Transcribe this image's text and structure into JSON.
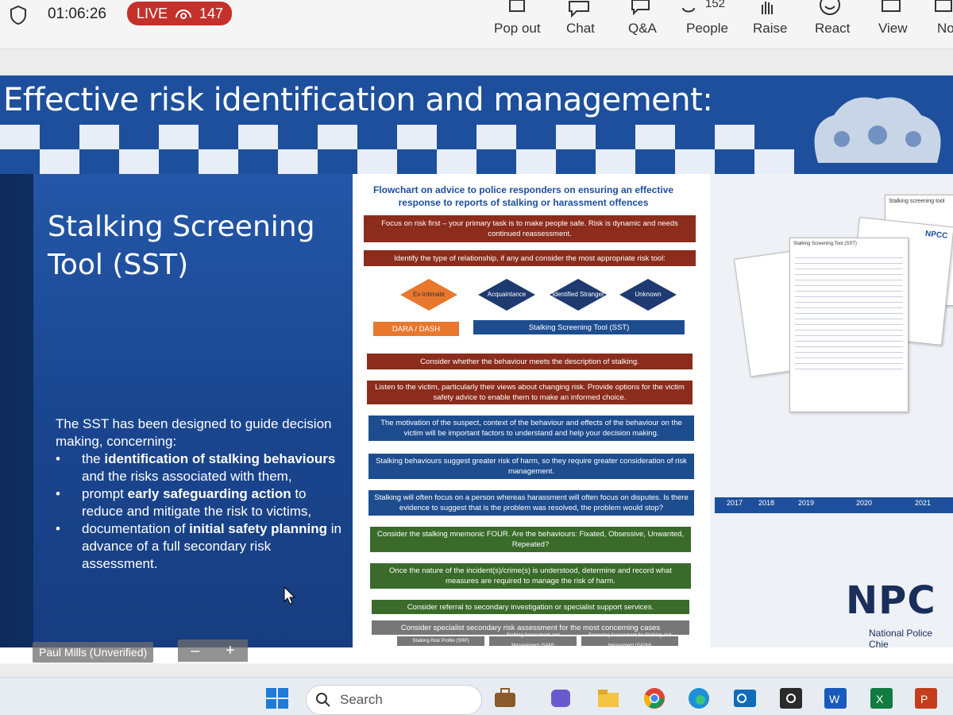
{
  "topbar": {
    "timer": "01:06:26",
    "live_label": "LIVE",
    "viewer_count": "147",
    "people_badge": "152",
    "buttons": [
      {
        "label": "Pop out",
        "icon": "pop-out-icon"
      },
      {
        "label": "Chat",
        "icon": "chat-icon"
      },
      {
        "label": "Q&A",
        "icon": "qa-icon"
      },
      {
        "label": "People",
        "icon": "people-icon"
      },
      {
        "label": "Raise",
        "icon": "raise-hand-icon"
      },
      {
        "label": "React",
        "icon": "react-icon"
      },
      {
        "label": "View",
        "icon": "view-icon"
      },
      {
        "label": "No",
        "icon": "notes-icon"
      }
    ]
  },
  "slide": {
    "title": "Effective risk identification and management:",
    "heading_line1": "Stalking Screening",
    "heading_line2": "Tool (SST)",
    "intro": "The SST has been designed to guide decision making, concerning:",
    "bullets": [
      {
        "pre": "the ",
        "bold": "identification of stalking behaviours",
        "post": " and the risks associated with them,"
      },
      {
        "pre": "prompt ",
        "bold": "early safeguarding action",
        "post": " to reduce and mitigate the risk to victims,"
      },
      {
        "pre": "documentation of ",
        "bold": "initial safety planning",
        "post": " in advance of a full secondary risk assessment."
      }
    ]
  },
  "flowchart": {
    "title": "Flowchart on advice to police responders on ensuring an effective response to reports of stalking or harassment offences",
    "step1": "Focus on risk first – your primary task is to make people safe. Risk is dynamic and needs continued reassessment.",
    "step2": "Identify the type of relationship, if any and consider the most appropriate risk tool:",
    "ex_intimate": "Ex-intimate",
    "acquaintance": "Acquaintance",
    "identified_stranger": "Identified Stranger",
    "unknown": "Unknown",
    "dara": "DARA / DASH",
    "sst_box": "Stalking Screening Tool (SST)",
    "step3": "Consider whether the behaviour meets the description of stalking.",
    "step4": "Listen to the victim, particularly their views about changing risk. Provide options for the victim safety advice to enable them to make an informed choice.",
    "step5": "The motivation of the suspect, context of the behaviour and effects of the behaviour on the victim will be important factors to understand and help your decision making.",
    "step6": "Stalking behaviours suggest greater risk of harm, so they require greater consideration of risk management.",
    "step7": "Stalking will often focus on a person whereas harassment will often focus on disputes. Is there evidence to suggest that is the problem was resolved, the problem would stop?",
    "step8": "Consider the stalking mnemonic FOUR. Are the behaviours: Fixated, Obsessive, Unwanted, Repeated?",
    "step9": "Once the nature of the incident(s)/crime(s) is understood, determine and record what measures are required to manage the risk of harm.",
    "step10": "Consider referral to secondary investigation or specialist support services.",
    "step11": "Consider specialist secondary risk assessment for the most concerning cases",
    "tools": [
      "Stalking Risk Profile (SRP)",
      "Stalking Assessment and Management (SAM)",
      "Screening Assessment for Stalking and Harassment (SASH)"
    ]
  },
  "right": {
    "doc_title": "Stalking screening tool",
    "paper_label": "Stalking Screening Tool (SST)",
    "npcc_small": "NPCC",
    "years": [
      "2017",
      "2018",
      "2019",
      "2020",
      "2021"
    ],
    "npcc_logo": "NPC",
    "npcc_sub": "National Police Chie"
  },
  "video": {
    "presenter": "Paul Mills (Unverified)",
    "zoom_out": "–",
    "zoom_in": "+"
  },
  "taskbar": {
    "search_placeholder": "Search",
    "apps": [
      "start-icon",
      "briefcase-icon",
      "copilot-icon",
      "file-explorer-icon",
      "chrome-icon",
      "edge-icon",
      "outlook-icon",
      "app-o-icon",
      "word-icon",
      "excel-icon",
      "powerpoint-icon"
    ]
  },
  "colors": {
    "live_red": "#c4312b",
    "slide_blue": "#1d4f9c",
    "flow_red": "#8b2c1c",
    "flow_blue": "#1e4d8f",
    "flow_green": "#3a6b2a",
    "flow_orange": "#e8782e"
  }
}
